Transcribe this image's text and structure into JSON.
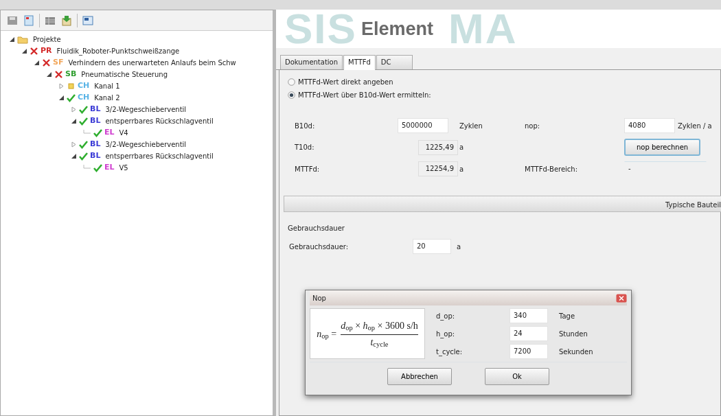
{
  "toolbar": {
    "buttons": [
      {
        "kind": "disk"
      },
      {
        "kind": "page"
      },
      {
        "kind": "sep"
      },
      {
        "kind": "grid"
      },
      {
        "kind": "export"
      },
      {
        "kind": "sep"
      },
      {
        "kind": "window"
      }
    ]
  },
  "tree": [
    {
      "label": "Projekte",
      "kind": "folder",
      "expanded": true,
      "children": [
        {
          "label": "Fluidik_Roboter-Punktschweißzange",
          "code": "PR",
          "color": "#d42a2a",
          "kind": "error",
          "expanded": true,
          "children": [
            {
              "label": "Verhindern des unerwarteten Anlaufs beim Schw",
              "code": "SF",
              "color": "#f2a65a",
              "kind": "error",
              "expanded": true,
              "children": [
                {
                  "label": "Pneumatische Steuerung",
                  "code": "SB",
                  "color": "#2f9e2f",
                  "kind": "error",
                  "expanded": true,
                  "children": [
                    {
                      "label": "Kanal 1",
                      "code": "CH",
                      "color": "#5ab4e6",
                      "kind": "partial",
                      "expanded": false
                    },
                    {
                      "label": "Kanal 2",
                      "code": "CH",
                      "color": "#5ab4e6",
                      "kind": "ok",
                      "expanded": true,
                      "children": [
                        {
                          "label": "3/2-Wegeschieberventil",
                          "code": "BL",
                          "color": "#3b3bd6",
                          "kind": "ok",
                          "expanded": false
                        },
                        {
                          "label": "entsperrbares Rückschlagventil",
                          "code": "BL",
                          "color": "#3b3bd6",
                          "kind": "ok",
                          "expanded": true,
                          "children": [
                            {
                              "label": "V4",
                              "code": "EL",
                              "color": "#d040d0",
                              "kind": "ok"
                            }
                          ]
                        },
                        {
                          "label": "3/2-Wegeschieberventil",
                          "code": "BL",
                          "color": "#3b3bd6",
                          "kind": "ok",
                          "expanded": false
                        },
                        {
                          "label": "entsperrbares Rückschlagventil",
                          "code": "BL",
                          "color": "#3b3bd6",
                          "kind": "ok",
                          "expanded": true,
                          "children": [
                            {
                              "label": "V5",
                              "code": "EL",
                              "color": "#d040d0",
                              "kind": "ok"
                            }
                          ]
                        }
                      ]
                    }
                  ]
                }
              ]
            }
          ]
        }
      ]
    }
  ],
  "header": {
    "logo_parts": [
      "SIS",
      "MA"
    ],
    "title": "Element"
  },
  "tabs": [
    {
      "label": "Dokumentation",
      "selected": false
    },
    {
      "label": "MTTFd",
      "selected": true
    },
    {
      "label": "DC",
      "selected": false
    }
  ],
  "options": [
    {
      "label": "MTTFd-Wert direkt angeben",
      "selected": false
    },
    {
      "label": "MTTFd-Wert über B10d-Wert ermitteln:",
      "selected": true
    }
  ],
  "fields": {
    "b10d": {
      "label": "B10d:",
      "value": "5000000",
      "unit": "Zyklen"
    },
    "nop": {
      "label": "nop:",
      "value": "4080",
      "unit": "Zyklen / a"
    },
    "t10d": {
      "label": "T10d:",
      "value": "1225,49",
      "unit": "a"
    },
    "nop_button": "nop berechnen",
    "mttfd": {
      "label": "MTTFd:",
      "value": "12254,9",
      "unit": "a"
    },
    "range": {
      "label": "MTTFd-Bereich:",
      "value": "-"
    }
  },
  "typical_bar": "Typische Bauteil",
  "usage": {
    "title": "Gebrauchsdauer",
    "label": "Gebrauchsdauer:",
    "value": "20",
    "unit": "a"
  },
  "dialog": {
    "title": "Nop",
    "formula": {
      "lhs": "*n*$_{op}$ =",
      "numerator": "*d*$_{op}$ × *h*$_{op}$ × 3600 s/h",
      "denominator": "*t*$_{cycle}$"
    },
    "inputs": [
      {
        "label": "d_op:",
        "value": "340",
        "unit": "Tage"
      },
      {
        "label": "h_op:",
        "value": "24",
        "unit": "Stunden"
      },
      {
        "label": "t_cycle:",
        "value": "7200",
        "unit": "Sekunden"
      }
    ],
    "buttons": [
      "Abbrechen",
      "Ok"
    ]
  }
}
